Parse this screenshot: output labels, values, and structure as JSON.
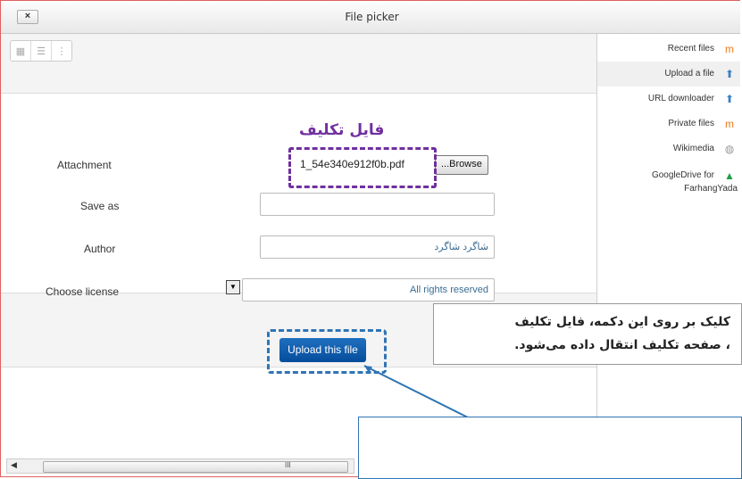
{
  "window": {
    "title": "File picker",
    "close_label": "×"
  },
  "sidebar": {
    "items": [
      {
        "label": "Recent files",
        "icon": "moodle-icon"
      },
      {
        "label": "Upload a file",
        "icon": "upload-icon"
      },
      {
        "label": "URL downloader",
        "icon": "url-icon"
      },
      {
        "label": "Private files",
        "icon": "moodle-icon"
      },
      {
        "label": "Wikimedia",
        "icon": "wikimedia-icon"
      },
      {
        "label": "GoogleDrive for",
        "label2": "FarhangYada",
        "icon": "googledrive-icon"
      }
    ]
  },
  "form": {
    "attachment_label": "Attachment",
    "attachment_file": "1_54e340e912f0b.pdf",
    "browse_label": "...Browse",
    "save_as_label": "Save as",
    "save_as_value": "",
    "author_label": "Author",
    "author_value": "شاگرد شاگرد",
    "license_label": "Choose license",
    "license_value": "All rights reserved",
    "upload_label": "Upload this file"
  },
  "annotations": {
    "file_callout": "فایل تکلیف",
    "note_line1": "کلیک بر روی این دکمه، فایل تکلیف",
    "note_line2": "، صفحه تکلیف انتقال داده می‌شود."
  },
  "scroll_glyph": "III"
}
